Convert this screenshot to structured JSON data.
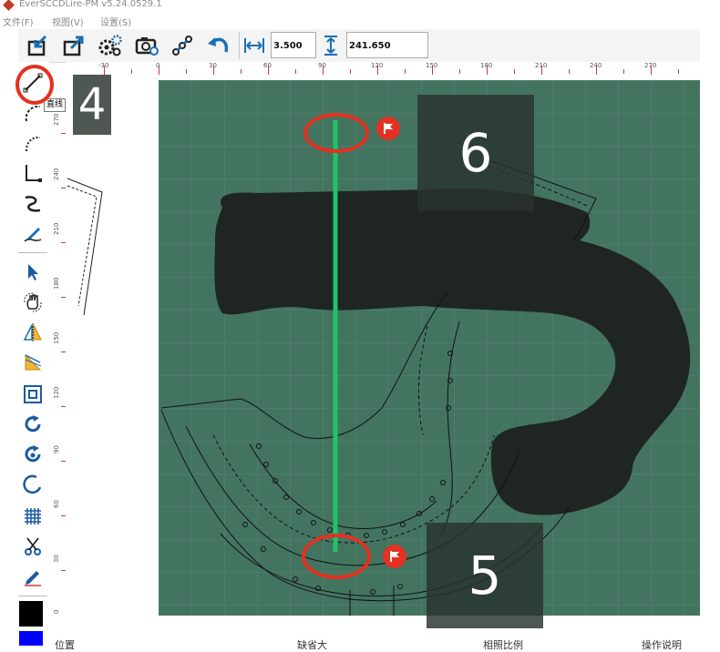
{
  "window": {
    "title": "EverSCCDLire-PM v5.24.0529.1"
  },
  "menu": {
    "items": [
      "文件(F)",
      "视图(V)",
      "设置(S)"
    ]
  },
  "toolbar": {
    "horizontal_value": "3.500",
    "vertical_value": "241.650"
  },
  "ruler": {
    "top_labels": [
      "-30",
      "0",
      "30",
      "60",
      "90",
      "120",
      "150",
      "180",
      "210",
      "240",
      "270"
    ],
    "left_labels": [
      "0",
      "30",
      "60",
      "90",
      "120",
      "150",
      "180",
      "210",
      "240",
      "270"
    ]
  },
  "tooltip": {
    "text": "直线"
  },
  "annotations": {
    "step4": "4",
    "step5": "5",
    "step6": "6"
  },
  "statusbar": {
    "items": [
      "位置",
      "缺省大",
      "相照比例",
      "操作说明"
    ]
  },
  "colors": {
    "accent_red": "#e53020",
    "line_green": "#1ec46a",
    "photo_background": "#3b6e5a",
    "toolbar_blue": "#1a6fb5",
    "swatch_primary": "#000000",
    "swatch_secondary": "#0000ff"
  },
  "icons": [
    "import-icon",
    "export-icon",
    "settings-gears-icon",
    "camera-settings-icon",
    "chain-icon",
    "undo-icon",
    "horizontal-measure-icon",
    "vertical-measure-icon",
    "line-tool-icon",
    "arc-tool-icon",
    "curve-tool-icon",
    "corner-tool-icon",
    "spline-tool-icon",
    "pen-tool-icon",
    "select-arrow-icon",
    "pan-hand-icon",
    "mirror-icon",
    "ruler-triangle-icon",
    "square-frame-icon",
    "rotate-icon",
    "rotate-target-icon",
    "ellipse-icon",
    "grid-icon",
    "scissors-icon",
    "pencil-icon",
    "flag-icon"
  ]
}
